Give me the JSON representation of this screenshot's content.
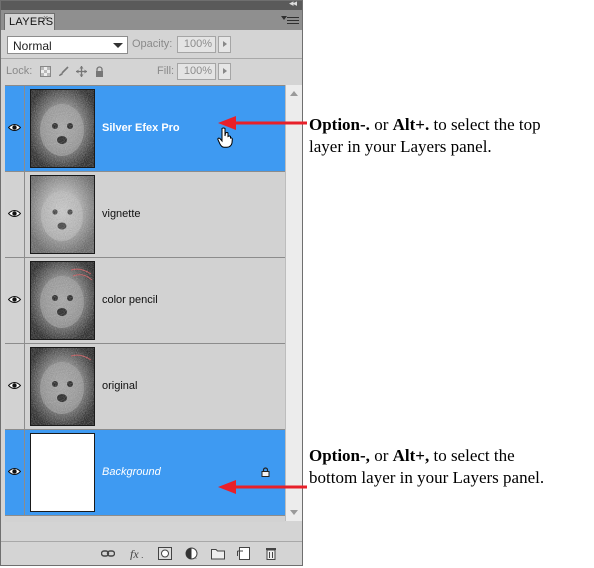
{
  "panel": {
    "tab_label": "LAYERS",
    "blend_mode": "Normal",
    "opacity_label": "Opacity:",
    "opacity_value": "100%",
    "lock_label": "Lock:",
    "fill_label": "Fill:",
    "fill_value": "100%"
  },
  "layers": [
    {
      "name": "Silver Efex Pro",
      "selected": true
    },
    {
      "name": "vignette",
      "selected": false
    },
    {
      "name": "color pencil",
      "selected": false
    },
    {
      "name": "original",
      "selected": false
    },
    {
      "name": "Background",
      "selected": true,
      "locked": true
    }
  ],
  "annotations": {
    "top": {
      "key1": "Option-.",
      "join": " or ",
      "key2": "Alt+.",
      "rest1": " to select the top",
      "line2": "layer in your Layers panel."
    },
    "bottom": {
      "key1": "Option-,",
      "join": " or ",
      "key2": "Alt+,",
      "rest1": " to select the",
      "line2": "bottom layer in your Layers panel."
    }
  },
  "colors": {
    "selection": "#3e9af2",
    "arrow": "#e8202a"
  }
}
